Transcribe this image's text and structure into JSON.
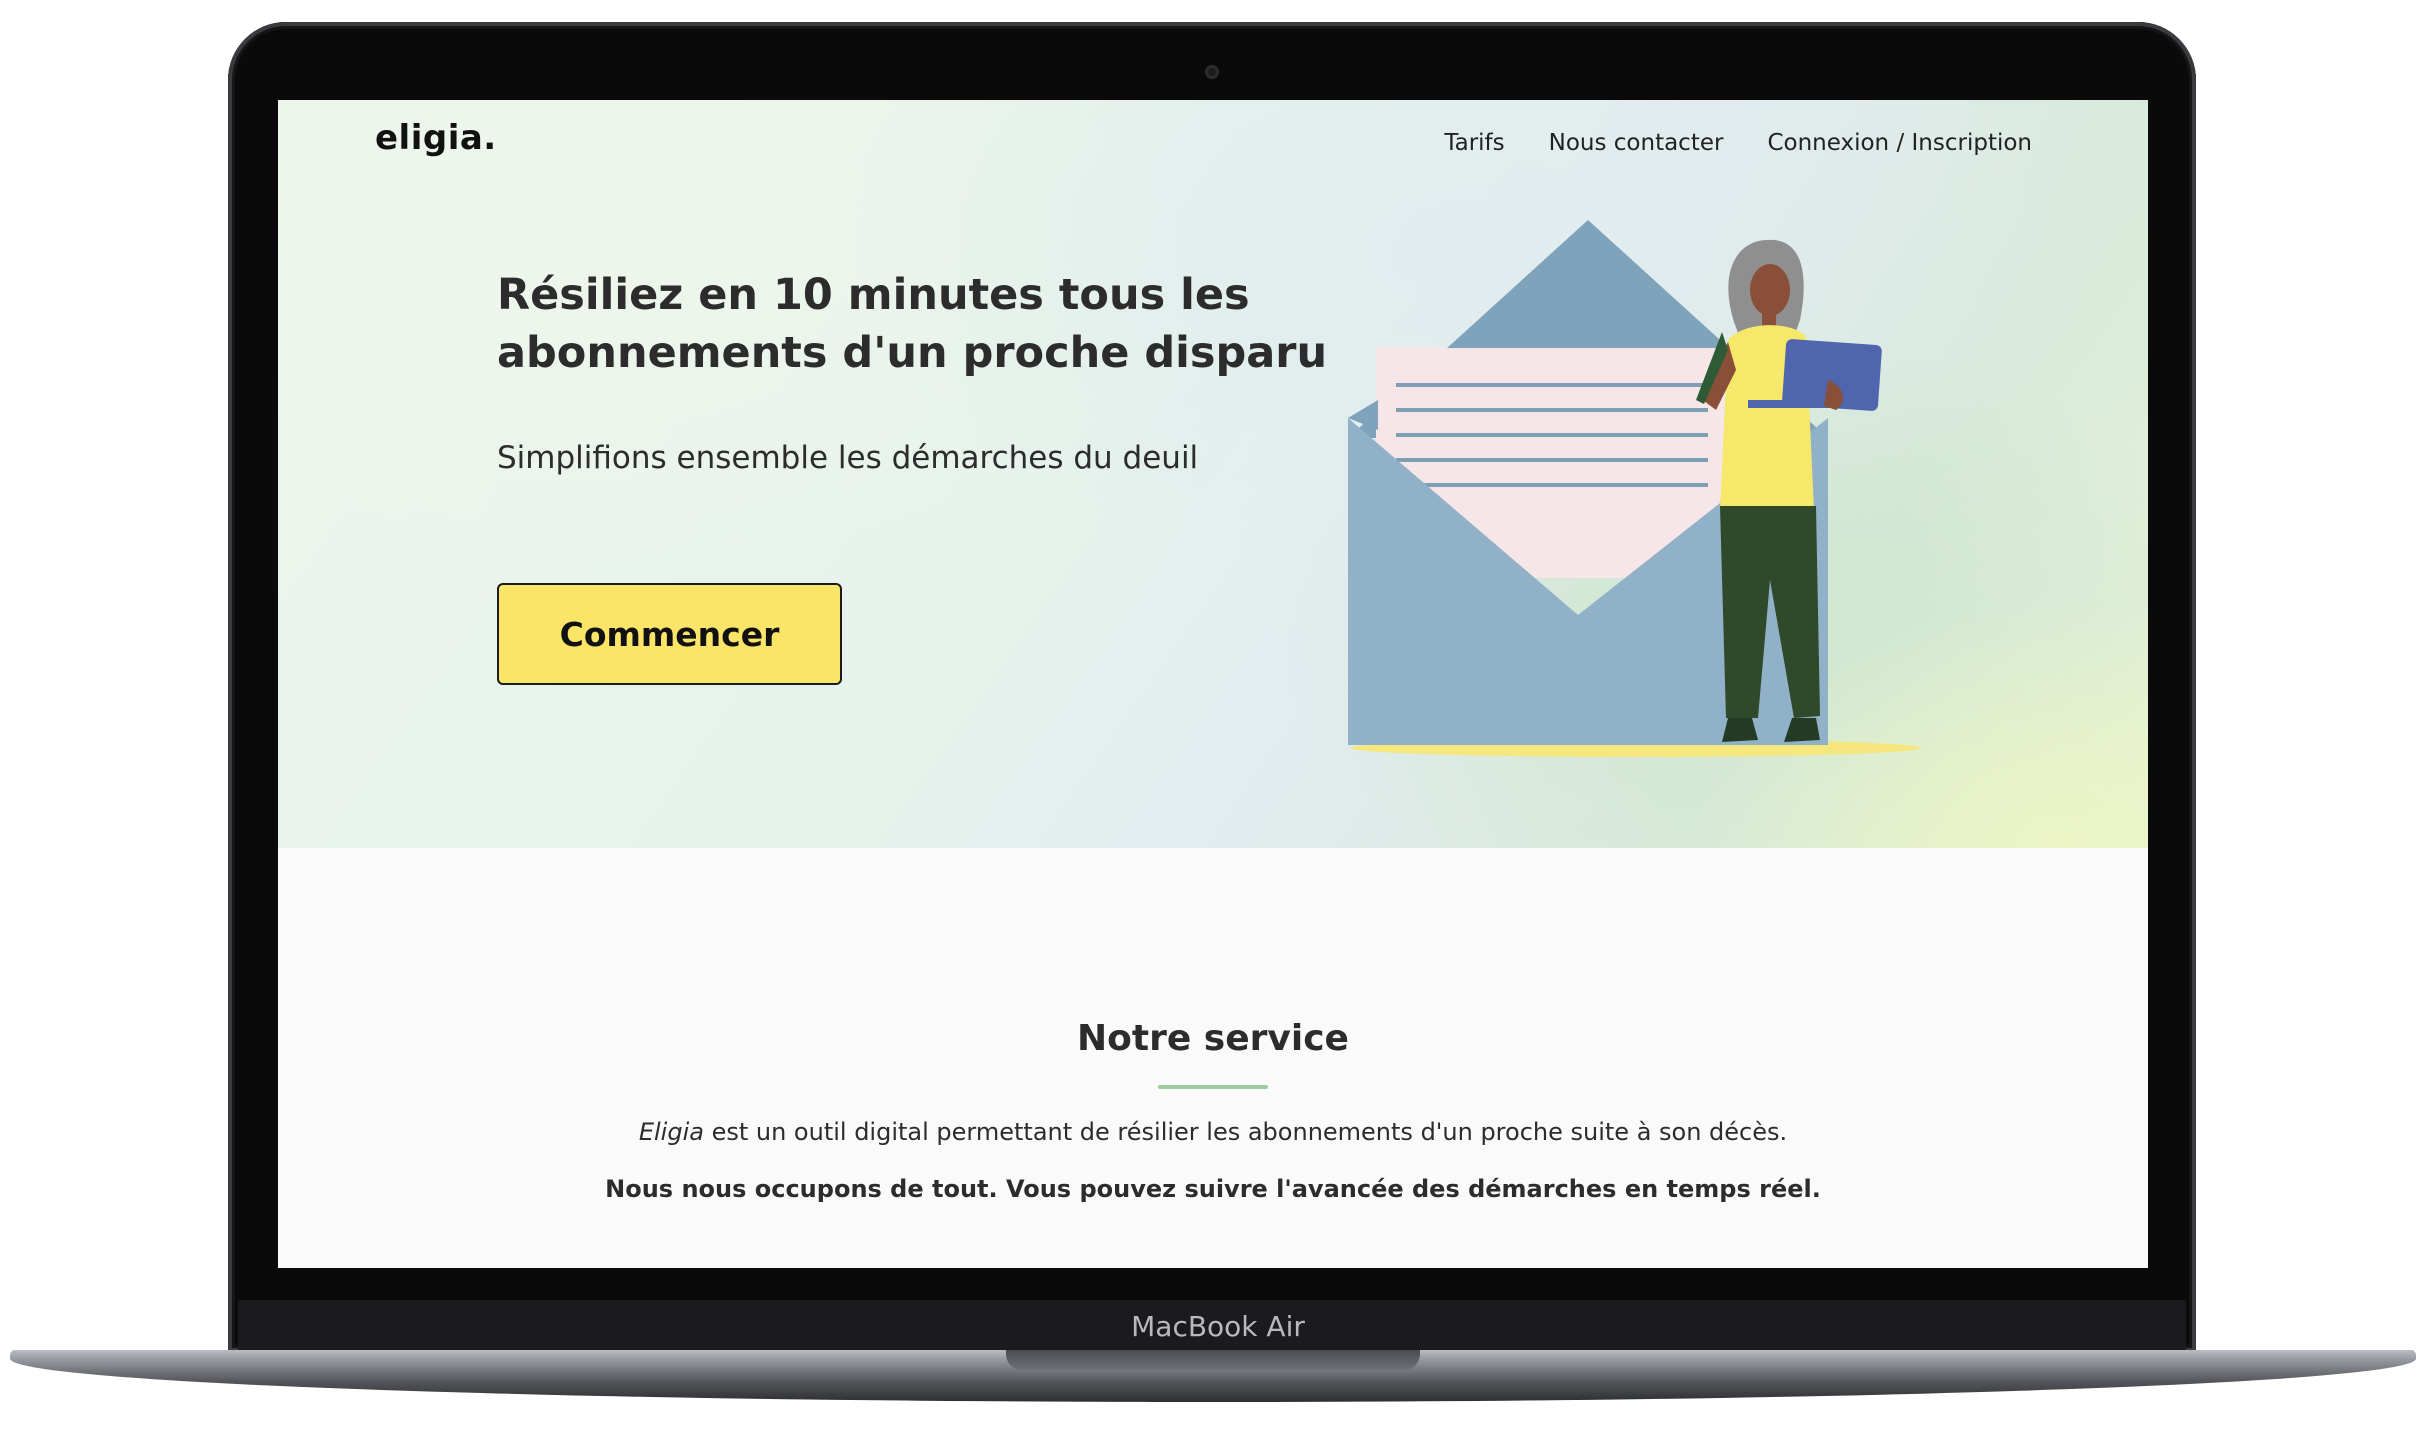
{
  "device": {
    "model_label": "MacBook Air"
  },
  "header": {
    "logo": "eligia.",
    "nav": [
      {
        "label": "Tarifs"
      },
      {
        "label": "Nous contacter"
      },
      {
        "label": "Connexion / Inscription"
      }
    ]
  },
  "hero": {
    "title": "Résiliez en 10 minutes tous les abonnements d'un proche disparu",
    "subtitle": "Simplifions ensemble les démarches du deuil",
    "cta_label": "Commencer"
  },
  "service": {
    "title": "Notre service",
    "intro_name": "Eligia",
    "intro_rest": " est un outil digital permettant de résilier les abonnements d'un proche suite à son décès.",
    "bold_line": "Nous nous occupons de tout. Vous pouvez suivre l'avancée des démarches en temps réel."
  },
  "colors": {
    "cta_background": "#fbe569",
    "accent_rule": "#9bcca2",
    "text": "#2c2c2c"
  },
  "icons": [
    "camera-icon",
    "envelope-illustration",
    "woman-with-laptop-illustration"
  ]
}
